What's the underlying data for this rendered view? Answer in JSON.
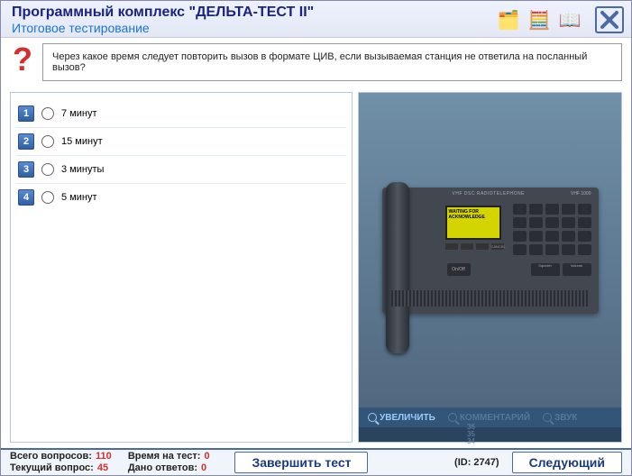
{
  "title": {
    "main": "Программный комплекс \"ДЕЛЬТА-ТЕСТ II\"",
    "sub": "Итоговое тестирование"
  },
  "question": {
    "text": "Через какое время следует повторить вызов в формате ЦИВ, если вызываемая станция не ответила на посланный вызов?"
  },
  "answers": [
    {
      "num": "1",
      "text": "7 минут"
    },
    {
      "num": "2",
      "text": "15 минут"
    },
    {
      "num": "3",
      "text": "3 минуты"
    },
    {
      "num": "4",
      "text": "5 минут"
    }
  ],
  "device": {
    "label": "VHF DSC RADIOTELEPHONE",
    "model": "VHF 1000",
    "lcd_line1": "WAITING FOR",
    "lcd_line2": "ACKNOWLEDGE",
    "btn_cancel": "CANCEL",
    "btn_onoff": "On/Off",
    "btn_squelch": "Squelch",
    "btn_volume": "Volume"
  },
  "image_toolbar": {
    "zoom": "УВЕЛИЧИТЬ",
    "comment": "КОММЕНТАРИЙ",
    "sound": "ЗВУК"
  },
  "ruler": {
    "top": "36",
    "mid": "35",
    "bot": "34"
  },
  "footer": {
    "total_label": "Всего вопросов:",
    "total_value": "110",
    "current_label": "Текущий вопрос:",
    "current_value": "45",
    "time_label": "Время на тест:",
    "time_value": "0",
    "given_label": "Дано ответов:",
    "given_value": "0",
    "finish": "Завершить тест",
    "id_label": "(ID: 2747)",
    "next": "Следующий"
  }
}
